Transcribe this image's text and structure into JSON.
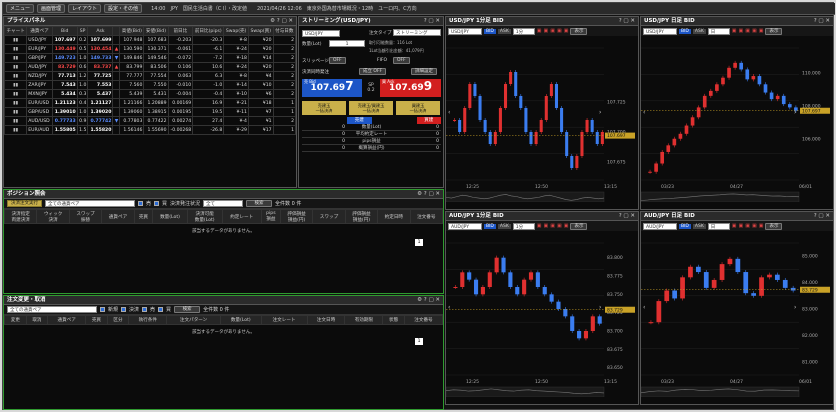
{
  "topbar": {
    "menu": "メニュー",
    "screen": "画面管理",
    "layout": "レイアウト",
    "settings": "設定・その他",
    "ticker": "14:00　JPY　国民生活白書（C I）・改定値　　2021/04/26 12:06　東京外国為替市場概況・12時　ユーロ円、C方向"
  },
  "price_panel": {
    "title": "プライスパネル",
    "headers": [
      "チャート",
      "通貨ペア",
      "Bid",
      "SP",
      "Ask",
      "",
      "高値(Bid)",
      "安値(Bid)",
      "前日比",
      "前日比(pips)",
      "Swap(売)",
      "Swap(買)",
      "付与日数"
    ],
    "rows": [
      {
        "pair": "USD/JPY",
        "bid": "107.697",
        "sp": "0.2",
        "ask": "107.699",
        "dir": "",
        "high": "107.948",
        "low": "107.683",
        "chg": "-0.203",
        "pips": "-20.3",
        "swap_s": "¥-8",
        "swap_b": "¥20",
        "days": "2",
        "c": "wh"
      },
      {
        "pair": "EUR/JPY",
        "bid": "130.449",
        "sp": "0.5",
        "ask": "130.454",
        "dir": "▲",
        "high": "130.590",
        "low": "130.371",
        "chg": "-0.061",
        "pips": "-6.1",
        "swap_s": "¥-24",
        "swap_b": "¥20",
        "days": "2",
        "c": "dn"
      },
      {
        "pair": "GBP/JPY",
        "bid": "149.723",
        "sp": "1.0",
        "ask": "149.733",
        "dir": "▼",
        "high": "149.846",
        "low": "149.546",
        "chg": "-0.072",
        "pips": "-7.2",
        "swap_s": "¥-18",
        "swap_b": "¥14",
        "days": "2",
        "c": "up"
      },
      {
        "pair": "AUD/JPY",
        "bid": "83.729",
        "sp": "0.6",
        "ask": "83.737",
        "dir": "▲",
        "high": "83.799",
        "low": "83.506",
        "chg": "0.106",
        "pips": "10.6",
        "swap_s": "¥-24",
        "swap_b": "¥20",
        "days": "2",
        "c": "dn"
      },
      {
        "pair": "NZD/JPY",
        "bid": "77.713",
        "sp": "1.2",
        "ask": "77.725",
        "dir": "",
        "high": "77.777",
        "low": "77.554",
        "chg": "0.063",
        "pips": "6.3",
        "swap_s": "¥-8",
        "swap_b": "¥4",
        "days": "2",
        "c": "wh"
      },
      {
        "pair": "ZAR/JPY",
        "bid": "7.543",
        "sp": "1.0",
        "ask": "7.553",
        "dir": "",
        "high": "7.560",
        "low": "7.550",
        "chg": "-0.010",
        "pips": "-1.0",
        "swap_s": "¥-14",
        "swap_b": "¥10",
        "days": "2",
        "c": "wh"
      },
      {
        "pair": "MXN/JPY",
        "bid": "5.434",
        "sp": "0.3",
        "ask": "5.437",
        "dir": "",
        "high": "5.439",
        "low": "5.431",
        "chg": "-0.004",
        "pips": "-0.4",
        "swap_s": "¥-10",
        "swap_b": "¥6",
        "days": "2",
        "c": "wh"
      },
      {
        "pair": "EUR/USD",
        "bid": "1.21123",
        "sp": "0.4",
        "ask": "1.21127",
        "dir": "",
        "high": "1.21166",
        "low": "1.20889",
        "chg": "0.00169",
        "pips": "16.9",
        "swap_s": "¥-21",
        "swap_b": "¥18",
        "days": "1",
        "c": "wh"
      },
      {
        "pair": "GBP/USD",
        "bid": "1.39010",
        "sp": "1.0",
        "ask": "1.39020",
        "dir": "",
        "high": "1.39060",
        "low": "1.38915",
        "chg": "0.00195",
        "pips": "19.5",
        "swap_s": "¥-11",
        "swap_b": "¥7",
        "days": "1",
        "c": "wh"
      },
      {
        "pair": "AUD/USD",
        "bid": "0.77733",
        "sp": "0.9",
        "ask": "0.77742",
        "dir": "▼",
        "high": "0.77803",
        "low": "0.77422",
        "chg": "0.00274",
        "pips": "27.4",
        "swap_s": "¥-4",
        "swap_b": "¥1",
        "days": "2",
        "c": "up"
      },
      {
        "pair": "EUR/AUD",
        "bid": "1.55805",
        "sp": "1.5",
        "ask": "1.55820",
        "dir": "",
        "high": "1.56146",
        "low": "1.55690",
        "chg": "-0.00268",
        "pips": "-26.8",
        "swap_s": "¥-29",
        "swap_b": "¥17",
        "days": "1",
        "c": "wh"
      }
    ]
  },
  "streaming": {
    "title": "ストリーミング(USD/JPY)",
    "pair": "USD/JPY",
    "order_type_label": "注文タイプ",
    "order_type": "ストリーミング",
    "qty_label": "数量(Lot)",
    "qty": "1",
    "qty_note": "取引可能数量：116 Lot",
    "qty_note2": "1Lot当額引出金額：41,079円",
    "slippage_label": "スリッページ",
    "slippage": "OFF",
    "fifo_label": "FIFO",
    "fifo": "OFF",
    "settle_label": "決済同時発注",
    "settle_btn": "成立 OFF",
    "detail_btn": "詳細設定",
    "bid_label": "売 Bid",
    "bid_main": "107.69",
    "bid_last": "7",
    "sp_label": "SP",
    "sp": "0.2",
    "ask_label": "買 Ask",
    "ask_main": "107.69",
    "ask_last": "9",
    "b1": "売建玉\n一括決済",
    "b2": "売建玉/買建玉\n一括決済",
    "b3": "買建玉\n一括決済",
    "sell_hdr": "売建",
    "buy_hdr": "買建",
    "rows": [
      {
        "label": "数量(Lot)",
        "s": "0",
        "b": "0"
      },
      {
        "label": "平均約定レート",
        "s": "0",
        "b": "0"
      },
      {
        "label": "pips損益",
        "s": "0",
        "b": "0"
      },
      {
        "label": "概算損益(円)",
        "s": "0",
        "b": "0"
      }
    ]
  },
  "position": {
    "title": "ポジション照会",
    "btn_settle": "決済注文実行",
    "all_pairs": "全ての通貨ペア",
    "sell": "売",
    "buy": "買",
    "status_label": "決済発注状況",
    "status": "全て",
    "search": "検索",
    "count": "全件数 0 件",
    "headers": [
      "決済指定\n両建決済",
      "ウィック\n決済",
      "スワップ\n振替",
      "通貨ペア",
      "売買",
      "数量(Lot)",
      "決済可能\n数量(Lot)",
      "約定レート",
      "pips\n損益",
      "評価損益\n損益(円)",
      "スワップ",
      "評価損益\n損益(円)",
      "約定日時",
      "注文番号"
    ],
    "empty": "該当するデータがありません。",
    "page": "1"
  },
  "orders": {
    "title": "注文変更・取消",
    "all_pairs": "全ての通貨ペア",
    "new": "新規",
    "settle": "決済",
    "sell": "売",
    "buy": "買",
    "search": "検索",
    "count": "全件数 0 件",
    "headers": [
      "変更",
      "取消",
      "通貨ペア",
      "売買",
      "区分",
      "執行条件",
      "注文パターン",
      "数量(Lot)",
      "注文レート",
      "注文日時",
      "有効期限",
      "状態",
      "注文番号"
    ],
    "empty": "該当するデータがありません。",
    "page": "1"
  },
  "charts": [
    {
      "title": "USD/JPY 1分足 BID",
      "pair": "USD/JPY",
      "tf": "1分",
      "show": "表示",
      "ticks": [
        "107.725",
        "107.700",
        "107.675"
      ],
      "price": "107.697",
      "dates": [
        "12:25",
        "12:50",
        "13:15"
      ],
      "chart_data": {
        "type": "line",
        "y": [
          107.71,
          107.7,
          107.72,
          107.74,
          107.73,
          107.71,
          107.7,
          107.69,
          107.7,
          107.72,
          107.74,
          107.75,
          107.73,
          107.72,
          107.7,
          107.69,
          107.7,
          107.71,
          107.73,
          107.74,
          107.72,
          107.7,
          107.68,
          107.67,
          107.68,
          107.7,
          107.71,
          107.7,
          107.69,
          107.7
        ],
        "ylim": [
          107.66,
          107.77
        ]
      }
    },
    {
      "title": "USD/JPY 日足 BID",
      "pair": "USD/JPY",
      "tf": "日",
      "show": "表示",
      "ticks": [
        "110.000",
        "108.000",
        "106.000"
      ],
      "price": "107.697",
      "dates": [
        "03/23",
        "04/27",
        "06/01"
      ],
      "chart_data": {
        "type": "line",
        "y": [
          104.0,
          104.5,
          105.2,
          105.6,
          106.0,
          106.3,
          106.8,
          107.3,
          107.9,
          108.6,
          108.9,
          109.3,
          109.7,
          110.3,
          110.6,
          110.2,
          109.6,
          109.8,
          109.3,
          108.8,
          108.4,
          108.6,
          108.1,
          107.9,
          107.7
        ],
        "ylim": [
          103.5,
          111.5
        ]
      }
    },
    {
      "title": "AUD/JPY 1分足 BID",
      "pair": "AUD/JPY",
      "tf": "1分",
      "show": "表示",
      "ticks": [
        "83.800",
        "83.775",
        "83.750",
        "83.725",
        "83.700",
        "83.675",
        "83.650"
      ],
      "price": "83.729",
      "dates": [
        "12:25",
        "12:50",
        "13:15"
      ],
      "chart_data": {
        "type": "line",
        "y": [
          83.76,
          83.78,
          83.77,
          83.75,
          83.76,
          83.78,
          83.8,
          83.78,
          83.76,
          83.75,
          83.77,
          83.78,
          83.76,
          83.75,
          83.74,
          83.73,
          83.72,
          83.7,
          83.69,
          83.7,
          83.72,
          83.71
        ],
        "ylim": [
          83.64,
          83.82
        ]
      }
    },
    {
      "title": "AUD/JPY 日足 BID",
      "pair": "AUD/JPY",
      "tf": "日",
      "show": "表示",
      "ticks": [
        "85.000",
        "84.000",
        "83.000",
        "82.000",
        "81.000"
      ],
      "price": "83.729",
      "dates": [
        "03/23",
        "04/27",
        "06/01"
      ],
      "chart_data": {
        "type": "line",
        "y": [
          82.5,
          83.3,
          83.7,
          83.4,
          84.2,
          84.6,
          84.4,
          83.8,
          84.1,
          84.7,
          84.9,
          84.4,
          83.6,
          83.5,
          84.2,
          84.3,
          84.1,
          83.8,
          83.7
        ],
        "ylim": [
          80.5,
          85.5
        ]
      }
    }
  ]
}
